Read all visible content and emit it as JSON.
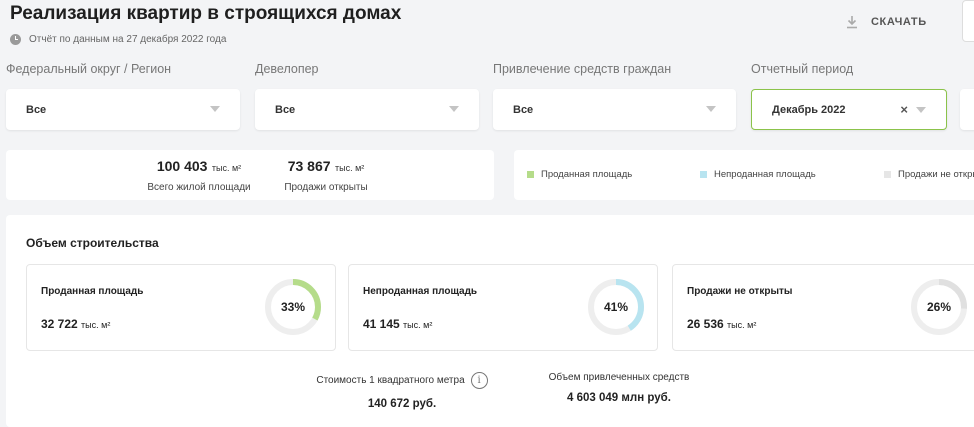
{
  "header": {
    "title": "Реализация квартир в строящихся домах",
    "report_note": "Отчёт по данным на 27 декабря 2022 года",
    "download_label": "СКАЧАТЬ"
  },
  "filters": [
    {
      "label": "Федеральный округ / Регион",
      "value": "Все"
    },
    {
      "label": "Девелопер",
      "value": "Все"
    },
    {
      "label": "Привлечение средств граждан",
      "value": "Все"
    },
    {
      "label": "Отчетный период",
      "value": "Декабрь 2022",
      "clear": "×"
    }
  ],
  "totals": [
    {
      "value": "100 403",
      "unit": "тыс. м²",
      "label": "Всего жилой площади"
    },
    {
      "value": "73 867",
      "unit": "тыс. м²",
      "label": "Продажи открыты"
    }
  ],
  "legend": [
    {
      "label": "Проданная площадь",
      "color": "#b5dc8a"
    },
    {
      "label": "Непроданная площадь",
      "color": "#b8e4f0"
    },
    {
      "label": "Продажи не открыты",
      "color": "#e6e6e6"
    }
  ],
  "construction": {
    "title": "Объем строительства",
    "metrics": [
      {
        "label": "Проданная площадь",
        "value": "32 722",
        "unit": "тыс. м²",
        "percent_text": "33%",
        "percent": 33,
        "color": "#b5dc8a"
      },
      {
        "label": "Непроданная площадь",
        "value": "41 145",
        "unit": "тыс. м²",
        "percent_text": "41%",
        "percent": 41,
        "color": "#b8e4f0"
      },
      {
        "label": "Продажи не открыты",
        "value": "26 536",
        "unit": "тыс. м²",
        "percent_text": "26%",
        "percent": 26,
        "color": "#e0e0e0"
      }
    ],
    "price_per_m2": {
      "label": "Стоимость 1 квадратного метра",
      "value": "140 672 руб."
    },
    "raised_funds": {
      "label": "Объем привлеченных средств",
      "value": "4 603 049 млн руб."
    }
  }
}
